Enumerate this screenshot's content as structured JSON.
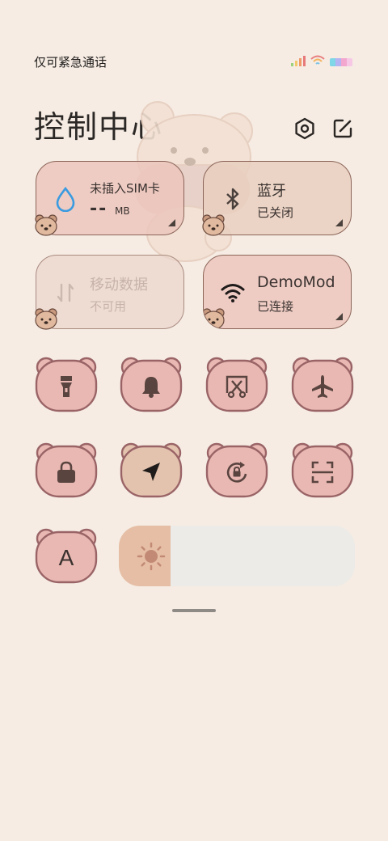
{
  "status_bar": {
    "carrier_text": "仅可紧急通话"
  },
  "header": {
    "title": "控制中心",
    "settings_icon": "gear-hexagon-icon",
    "edit_icon": "edit-pencil-icon"
  },
  "tiles": {
    "data_usage": {
      "main": "未插入SIM卡",
      "value": "--",
      "unit": "MB"
    },
    "bluetooth": {
      "name": "蓝牙",
      "status": "已关闭"
    },
    "mobile_data": {
      "name": "移动数据",
      "status": "不可用"
    },
    "wifi": {
      "name": "DemoMod",
      "status": "已连接"
    }
  },
  "toggles": [
    {
      "name": "flashlight",
      "icon": "flashlight-icon"
    },
    {
      "name": "bell",
      "icon": "bell-icon"
    },
    {
      "name": "screenshot",
      "icon": "screenshot-scissors-icon"
    },
    {
      "name": "airplane",
      "icon": "airplane-icon"
    },
    {
      "name": "lock",
      "icon": "lock-icon"
    },
    {
      "name": "location",
      "icon": "location-arrow-icon"
    },
    {
      "name": "rotation-lock",
      "icon": "rotation-lock-icon"
    },
    {
      "name": "scanner",
      "icon": "scanner-icon"
    },
    {
      "name": "font",
      "icon": "font-letter-icon",
      "label": "A"
    }
  ],
  "brightness": {
    "level": 0.22
  },
  "colors": {
    "background": "#f6ece3",
    "bear_pink": "#e9b8b2",
    "bear_active": "#e3c3ae",
    "outline": "#9a6467",
    "glyph": "#5a4440"
  }
}
